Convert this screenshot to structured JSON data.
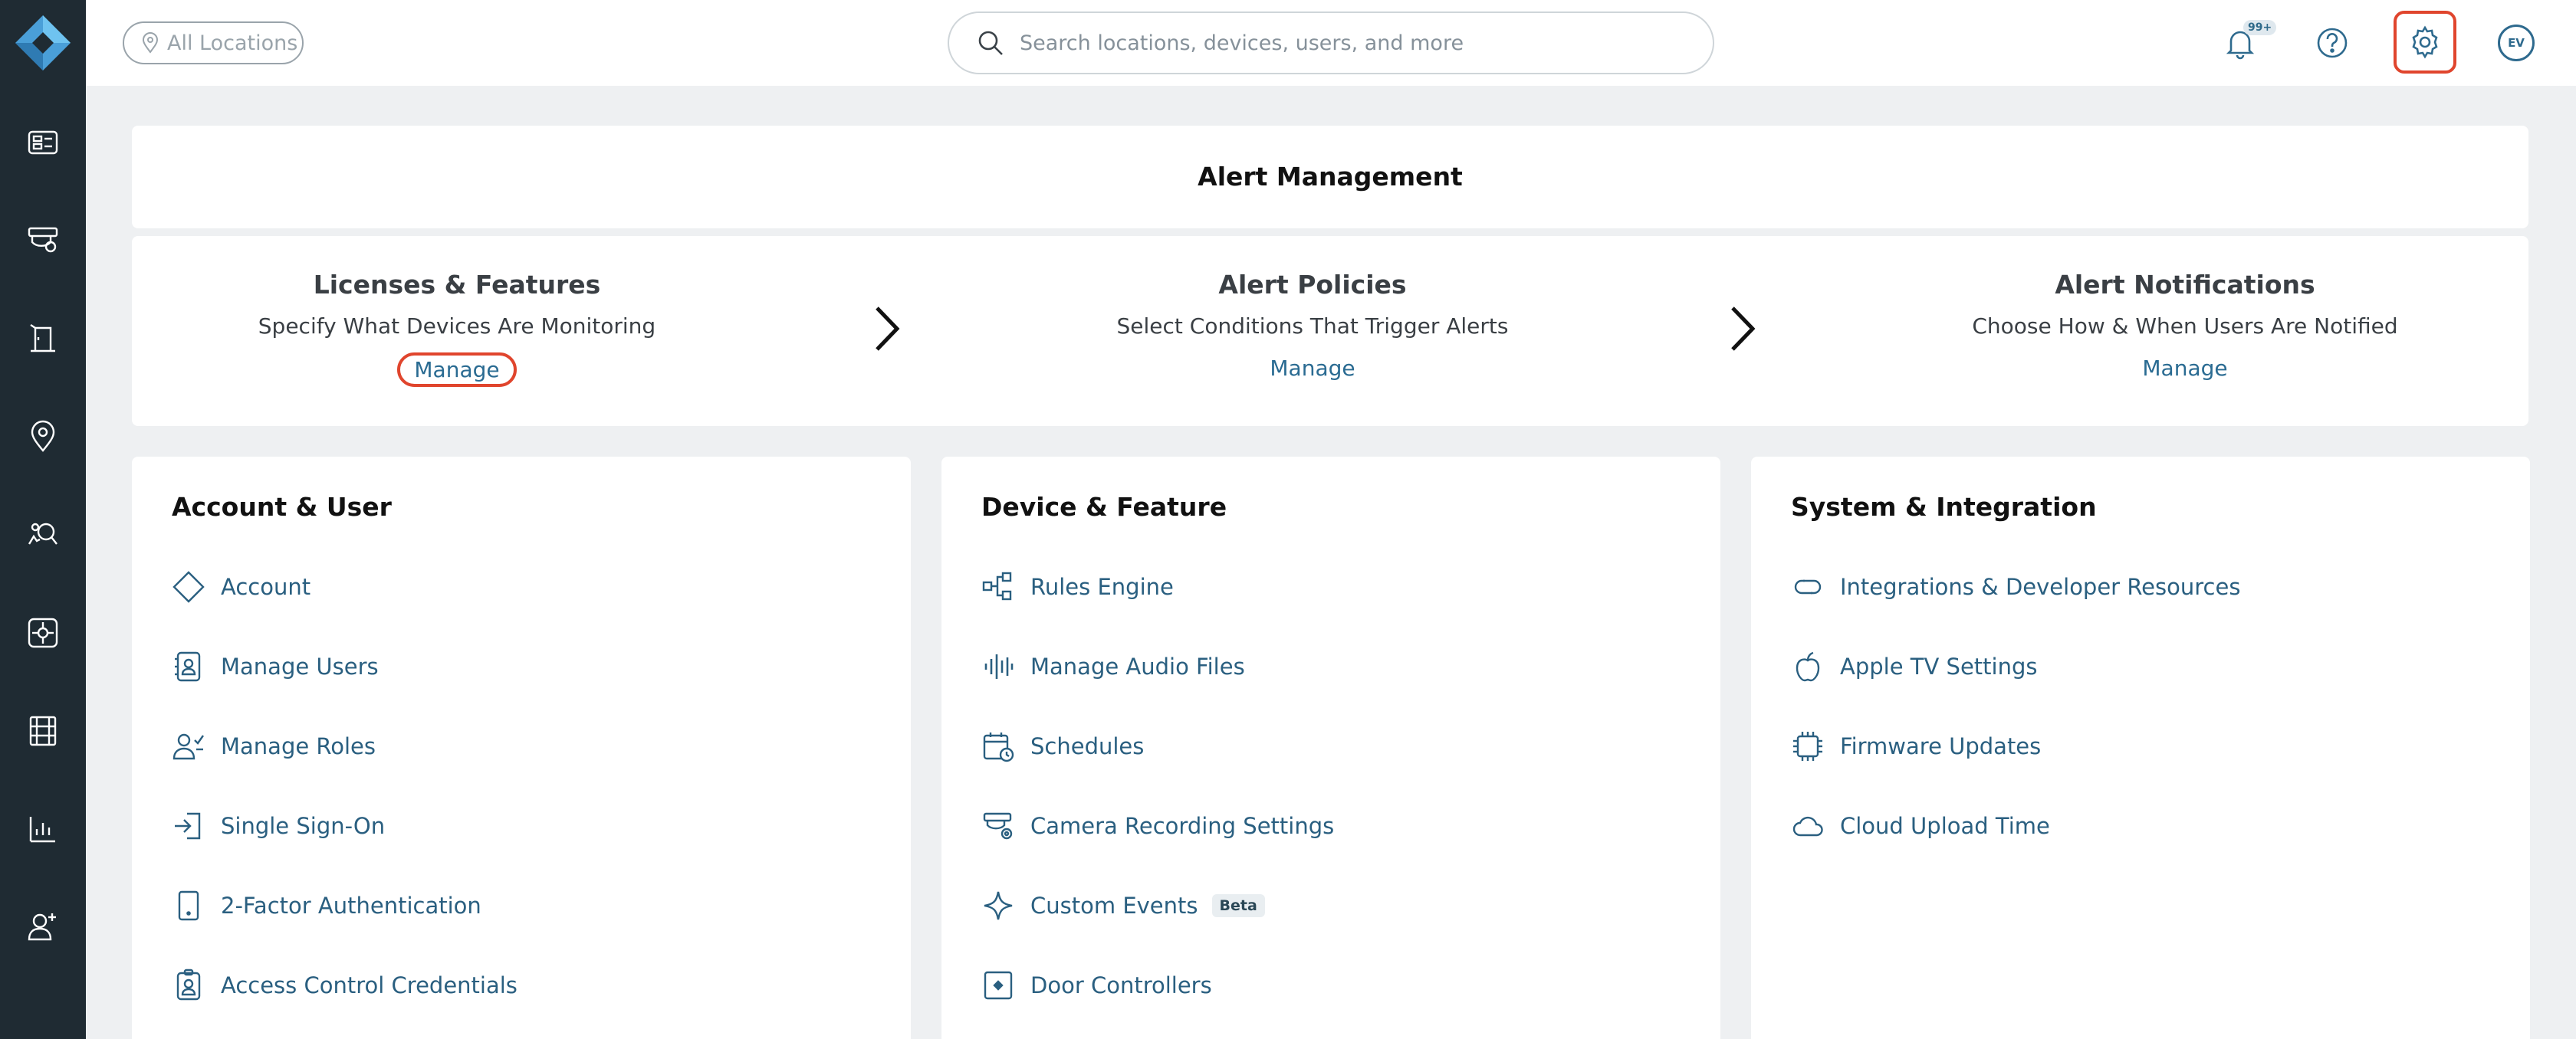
{
  "topbar": {
    "location_label": "All Locations",
    "search_placeholder": "Search locations, devices, users, and more",
    "notification_badge": "99+",
    "avatar_initials": "EV"
  },
  "alert": {
    "title": "Alert Management",
    "steps": [
      {
        "title": "Licenses & Features",
        "desc": "Specify What Devices Are Monitoring",
        "link": "Manage"
      },
      {
        "title": "Alert Policies",
        "desc": "Select Conditions That Trigger Alerts",
        "link": "Manage"
      },
      {
        "title": "Alert Notifications",
        "desc": "Choose How & When Users Are Notified",
        "link": "Manage"
      }
    ]
  },
  "sections": {
    "account": {
      "title": "Account & User",
      "items": [
        "Account",
        "Manage Users",
        "Manage Roles",
        "Single Sign-On",
        "2-Factor Authentication",
        "Access Control Credentials"
      ]
    },
    "device": {
      "title": "Device & Feature",
      "items": [
        "Rules Engine",
        "Manage Audio Files",
        "Schedules",
        "Camera Recording Settings",
        "Custom Events",
        "Door Controllers"
      ],
      "beta_label": "Beta"
    },
    "system": {
      "title": "System & Integration",
      "items": [
        "Integrations & Developer Resources",
        "Apple TV Settings",
        "Firmware Updates",
        "Cloud Upload Time"
      ]
    }
  },
  "colors": {
    "sidebar": "#1f2b33",
    "accent": "#2a6b92",
    "highlight": "#e0452d",
    "background": "#eef0f2"
  }
}
